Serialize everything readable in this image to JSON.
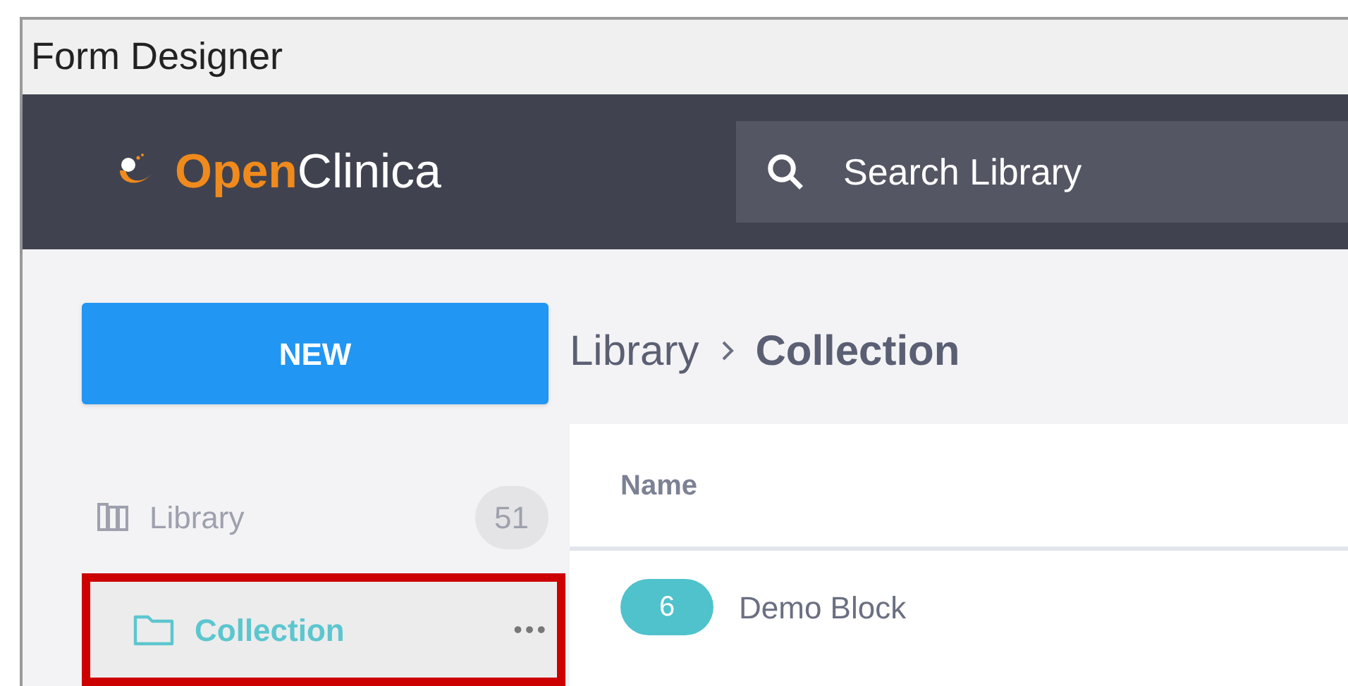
{
  "window": {
    "title": "Form Designer"
  },
  "header": {
    "logo": "**Open**Clinica",
    "search": {
      "placeholder": "Search Library"
    }
  },
  "sidebar": {
    "new_button": "NEW",
    "items": [
      {
        "kind": "library",
        "label": "Library",
        "count": "51",
        "selected": false,
        "highlighted": false
      },
      {
        "kind": "folder",
        "label": "Collection",
        "selected": true,
        "highlighted": true,
        "menu": "•••"
      }
    ]
  },
  "breadcrumb": [
    "Library",
    "Collection"
  ],
  "table": {
    "columns": [
      "Name"
    ],
    "rows": [
      {
        "badge": "6",
        "name": "Demo Block"
      }
    ]
  }
}
